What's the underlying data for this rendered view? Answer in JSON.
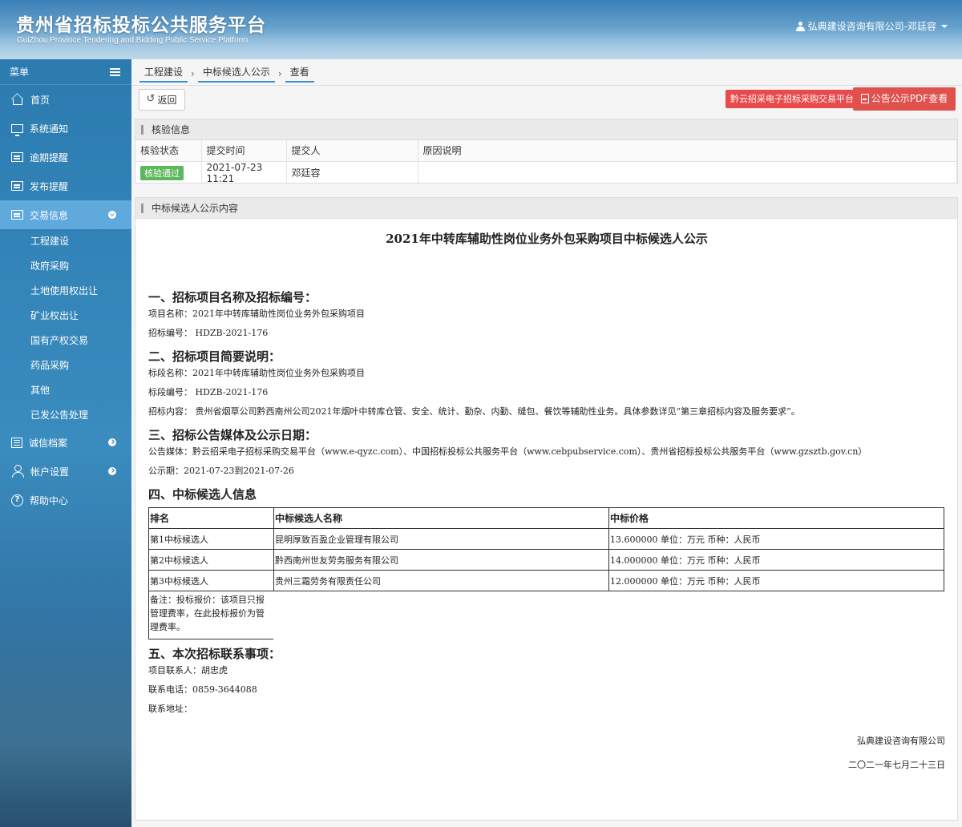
{
  "header": {
    "title": "贵州省招标投标公共服务平台",
    "subtitle": "GuiZhou Province Tendering and Bidding Public Service Platform",
    "user": "弘典建设咨询有限公司-邓廷容"
  },
  "sidebar": {
    "menu_label": "菜单",
    "items": [
      {
        "label": "首页",
        "icon": "home-icon"
      },
      {
        "label": "系统通知",
        "icon": "monitor-icon"
      },
      {
        "label": "逾期提醒",
        "icon": "box-icon"
      },
      {
        "label": "发布提醒",
        "icon": "box-icon"
      },
      {
        "label": "交易信息",
        "icon": "box-icon"
      },
      {
        "label": "诚信档案",
        "icon": "list-icon"
      },
      {
        "label": "帐户设置",
        "icon": "user-icon"
      },
      {
        "label": "帮助中心",
        "icon": "help-icon"
      }
    ],
    "sub_items": [
      "工程建设",
      "政府采购",
      "土地使用权出让",
      "矿业权出让",
      "国有产权交易",
      "药品采购",
      "其他",
      "已发公告处理"
    ]
  },
  "breadcrumb": [
    "工程建设",
    "中标候选人公示",
    "查看"
  ],
  "toolbar": {
    "back_label": "返回",
    "platform_label": "黔云招采电子招标采购交易平台",
    "pdf_label": "公告公示PDF查看"
  },
  "verify": {
    "title": "核验信息",
    "headers": [
      "核验状态",
      "提交时间",
      "提交人",
      "原因说明"
    ],
    "status": "核验通过",
    "time": "2021-07-23 11:21",
    "submitter": "邓廷容",
    "reason": ""
  },
  "content": {
    "panel_title": "中标候选人公示内容",
    "doc_title": "2021年中转库辅助性岗位业务外包采购项目中标候选人公示",
    "s1": "一、招标项目名称及招标编号：",
    "s1_line1": "项目名称：2021年中转库辅助性岗位业务外包采购项目",
    "s1_line2": "招标编号： HDZB-2021-176",
    "s2": "二、招标项目简要说明：",
    "s2_line1": "标段名称：2021年中转库辅助性岗位业务外包采购项目",
    "s2_line2": "标段编号： HDZB-2021-176",
    "s2_line3": "招标内容： 贵州省烟草公司黔西南州公司2021年烟叶中转库仓管、安全、统计、勤杂、内勤、缝包、餐饮等辅助性业务。具体参数详见“第三章招标内容及服务要求”。",
    "s3": "三、招标公告媒体及公示日期：",
    "s3_line1": "公告媒体：黔云招采电子招标采购交易平台（www.e-qyzc.com）、中国招标投标公共服务平台（www.cebpubservice.com）、贵州省招标投标公共服务平台（www.gzsztb.gov.cn）",
    "s3_line2": "公示期：2021-07-23到2021-07-26",
    "s4": "四、中标候选人信息",
    "cand_headers": [
      "排名",
      "中标候选人名称",
      "中标价格"
    ],
    "candidates": [
      {
        "rank": "第1中标候选人",
        "name": "昆明厚致百盈企业管理有限公司",
        "price": "13.600000 单位：万元 币种：人民币"
      },
      {
        "rank": "第2中标候选人",
        "name": "黔西南州世友劳务服务有限公司",
        "price": "14.000000 单位：万元 币种：人民币"
      },
      {
        "rank": "第3中标候选人",
        "name": "贵州三霜劳务有限责任公司",
        "price": "12.000000 单位：万元 币种：人民币"
      }
    ],
    "note": "备注：投标报价：该项目只报管理费率，在此投标报价为管理费率。",
    "s5": "五、本次招标联系事项：",
    "s5_line1": "项目联系人：胡忠虎",
    "s5_line2": "联系电话：0859-3644088",
    "s5_line3": "联系地址：",
    "signer": "弘典建设咨询有限公司",
    "date": "二〇二一年七月二十三日"
  }
}
